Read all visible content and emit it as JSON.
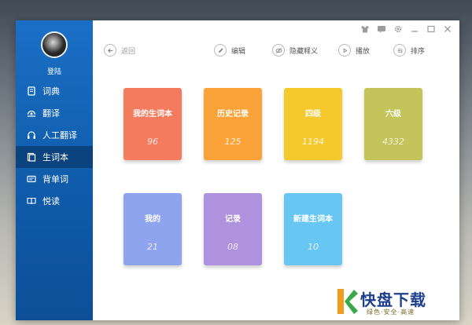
{
  "sidebar": {
    "login_label": "登陆",
    "items": [
      {
        "label": "词典",
        "icon": "dictionary-icon"
      },
      {
        "label": "翻译",
        "icon": "translate-icon"
      },
      {
        "label": "人工翻译",
        "icon": "headphones-icon"
      },
      {
        "label": "生词本",
        "icon": "wordbook-icon",
        "active": true
      },
      {
        "label": "背单词",
        "icon": "flashcard-icon"
      },
      {
        "label": "悦读",
        "icon": "reading-icon"
      }
    ]
  },
  "toolbar": {
    "back_label": "返回",
    "edit_label": "编辑",
    "hide_label": "隐藏释义",
    "play_label": "播放",
    "sort_label": "排序"
  },
  "titlebar_icons": [
    "shirt-icon",
    "message-icon",
    "gear-icon",
    "minimize-icon",
    "maximize-icon",
    "close-icon"
  ],
  "cards": [
    {
      "title": "我的生词本",
      "count": "96",
      "color": "#f47b5e"
    },
    {
      "title": "历史记录",
      "count": "125",
      "color": "#fba338"
    },
    {
      "title": "四级",
      "count": "1194",
      "color": "#f5c92d"
    },
    {
      "title": "六级",
      "count": "4332",
      "color": "#c3c45a"
    },
    {
      "title": "我的",
      "count": "21",
      "color": "#8fa4ee"
    },
    {
      "title": "记录",
      "count": "08",
      "color": "#af92dd"
    },
    {
      "title": "新建生词本",
      "count": "10",
      "color": "#68c7f2"
    }
  ],
  "watermark": {
    "brand": "快盘下载",
    "slogan": "绿色·安全·高速"
  },
  "colors": {
    "sidebar": "#1466b8",
    "active_item": "#0b437f"
  }
}
